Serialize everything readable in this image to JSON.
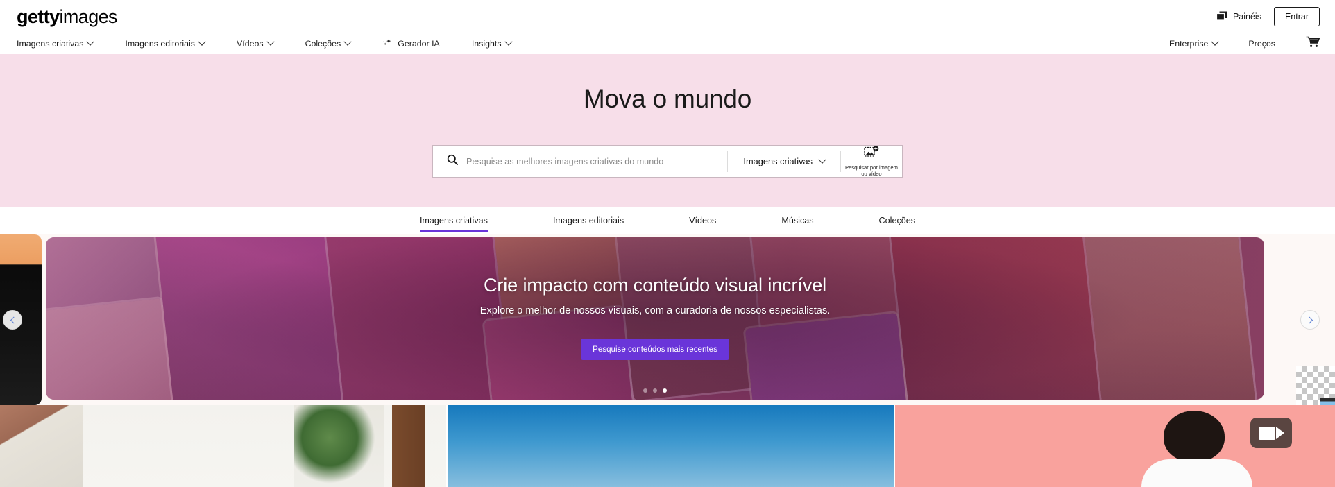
{
  "header": {
    "logo_bold": "getty",
    "logo_light": "images",
    "boards_label": "Painéis",
    "boards_icon": "boards-icon",
    "signin_label": "Entrar"
  },
  "nav": {
    "left_items": [
      {
        "label": "Imagens criativas",
        "has_chevron": true,
        "icon": null
      },
      {
        "label": "Imagens editoriais",
        "has_chevron": true,
        "icon": null
      },
      {
        "label": "Vídeos",
        "has_chevron": true,
        "icon": null
      },
      {
        "label": "Coleções",
        "has_chevron": true,
        "icon": null
      },
      {
        "label": "Gerador IA",
        "has_chevron": false,
        "icon": "ai-sparkle-icon"
      },
      {
        "label": "Insights",
        "has_chevron": true,
        "icon": null
      }
    ],
    "right_items": [
      {
        "label": "Enterprise",
        "has_chevron": true
      },
      {
        "label": "Preços",
        "has_chevron": false
      }
    ],
    "cart_icon": "shopping-cart-icon"
  },
  "hero": {
    "title": "Mova o mundo",
    "background_color": "#f7dee9",
    "search": {
      "search_icon": "search-icon",
      "placeholder": "Pesquise as melhores imagens criativas do mundo",
      "value": "",
      "type_selector": "Imagens criativas",
      "type_chevron_icon": "chevron-down-icon",
      "visual_search_icon": "image-upload-search-icon",
      "visual_search_label": "Pesquisar por imagem ou vídeo"
    }
  },
  "content_tabs": {
    "items": [
      {
        "label": "Imagens criativas",
        "active": true
      },
      {
        "label": "Imagens editoriais",
        "active": false
      },
      {
        "label": "Vídeos",
        "active": false
      },
      {
        "label": "Músicas",
        "active": false
      },
      {
        "label": "Coleções",
        "active": false
      }
    ],
    "active_underline_color": "#6a35d9"
  },
  "carousel": {
    "prev_icon": "chevron-left-icon",
    "next_icon": "chevron-right-icon",
    "slide": {
      "title": "Crie impacto com conteúdo visual incrível",
      "subtitle": "Explore o melhor de nossos visuais, com a curadoria de nossos especialistas.",
      "cta_label": "Pesquise conteúdos mais recentes",
      "cta_color": "#6a35d9"
    },
    "dots": [
      {
        "active": false
      },
      {
        "active": false
      },
      {
        "active": true
      }
    ]
  },
  "gallery": {
    "panels": [
      {
        "name": "street-scene-photo"
      },
      {
        "name": "blue-sky-photo"
      },
      {
        "name": "coral-portrait-photo"
      }
    ],
    "video_badge_icon": "video-camera-icon",
    "coral_color": "#f9a29d"
  }
}
